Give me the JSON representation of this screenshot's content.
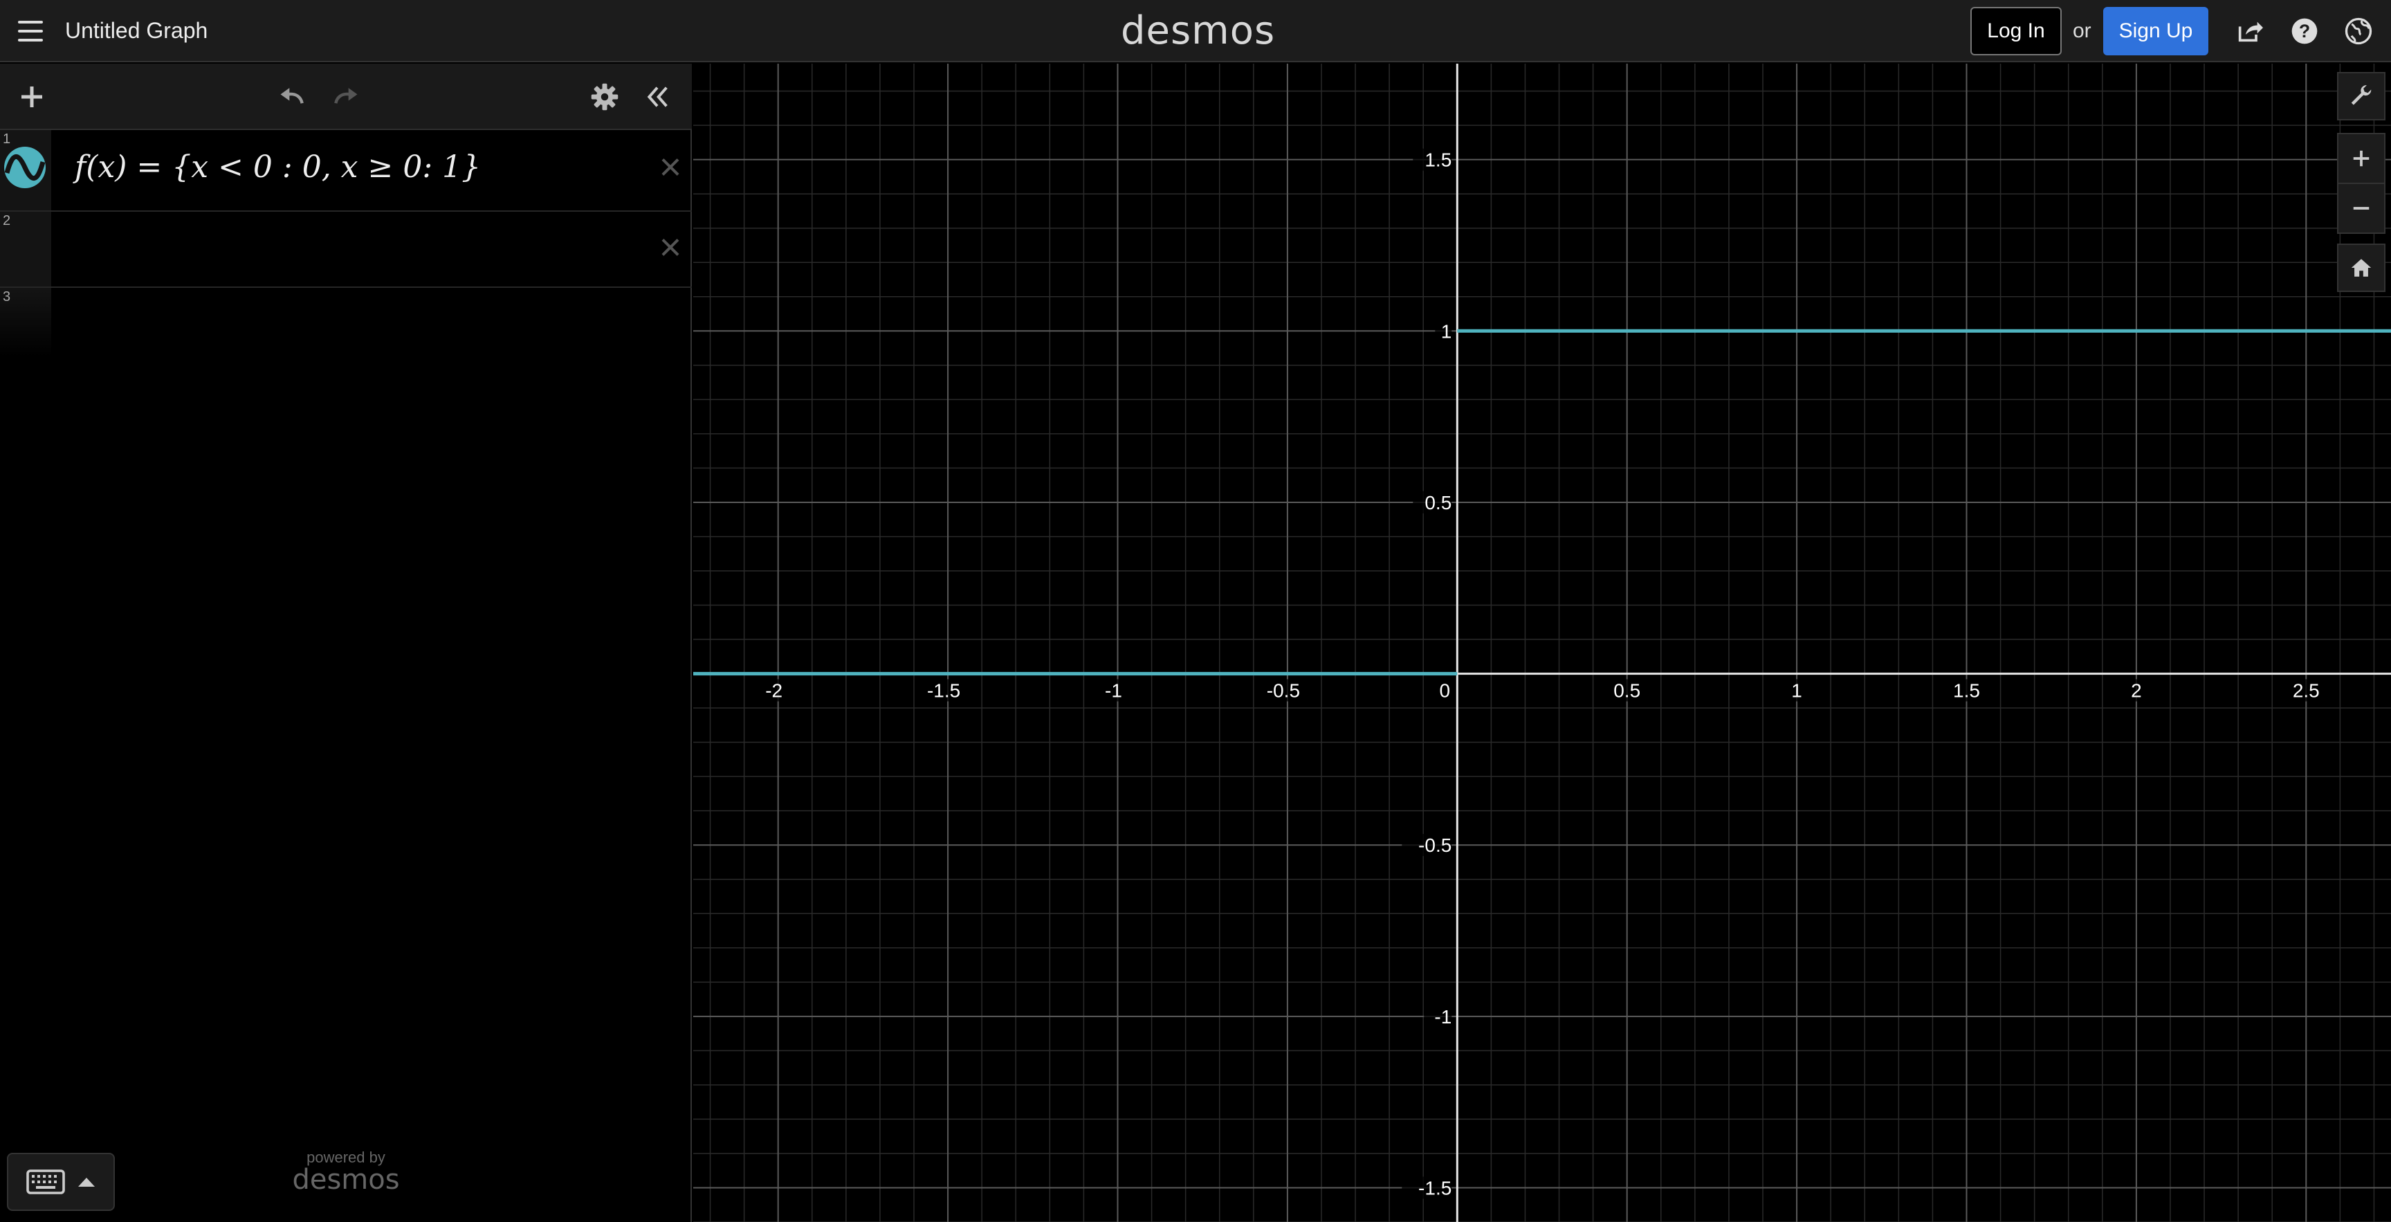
{
  "header": {
    "title": "Untitled Graph",
    "logo": "desmos",
    "login_label": "Log In",
    "or_label": "or",
    "signup_label": "Sign Up",
    "icons": [
      "menu-icon",
      "share-icon",
      "help-icon",
      "globe-icon"
    ]
  },
  "toolbar": {
    "icons": [
      "plus-icon",
      "undo-icon",
      "redo-icon",
      "gear-icon",
      "collapse-icon"
    ]
  },
  "expressions": [
    {
      "number": "1",
      "latex": "f(x) = {x < 0 : 0, x ≥ 0: 1}"
    },
    {
      "number": "2",
      "latex": ""
    },
    {
      "number": "3",
      "latex": ""
    }
  ],
  "footer": {
    "powered_by": "powered by",
    "brand": "desmos"
  },
  "graph": {
    "curve_color": "#4fb3bf",
    "x_range": [
      -2.25,
      2.75
    ],
    "y_range": [
      -1.6,
      1.78
    ],
    "x_ticks": [
      "-2",
      "-1.5",
      "-1",
      "-0.5",
      "0",
      "0.5",
      "1",
      "1.5",
      "2",
      "2.5"
    ],
    "y_ticks": [
      "1.5",
      "1",
      "0.5",
      "-0.5",
      "-1",
      "-1.5"
    ]
  },
  "chart_data": {
    "type": "line",
    "series": [
      {
        "x": [
          -2.25,
          0
        ],
        "y": [
          0,
          0
        ]
      },
      {
        "x": [
          0,
          2.75
        ],
        "y": [
          1,
          1
        ]
      }
    ],
    "xlim": [
      -2.25,
      2.75
    ],
    "ylim": [
      -1.6,
      1.78
    ],
    "grid": true
  }
}
